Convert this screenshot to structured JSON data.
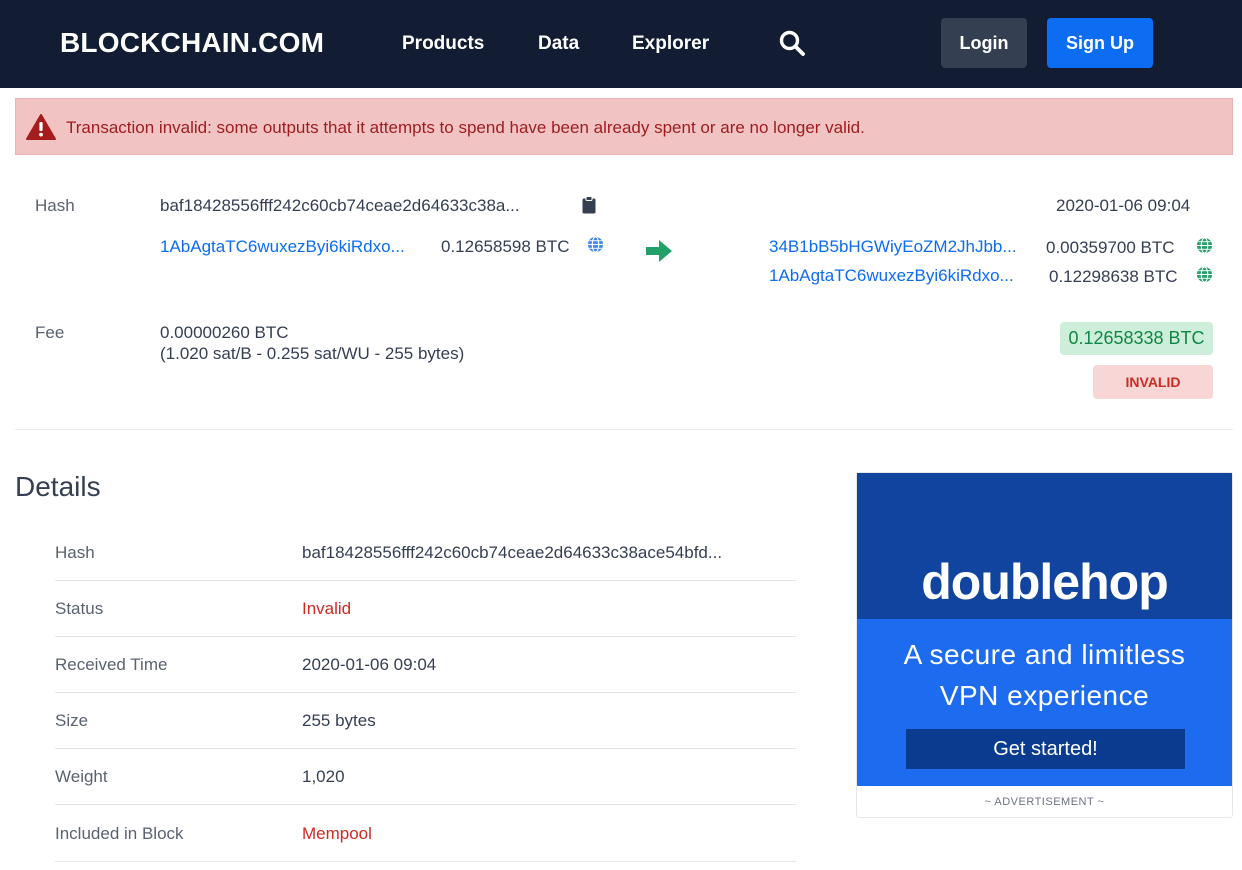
{
  "header": {
    "logo": "BLOCKCHAIN.COM",
    "nav": [
      "Products",
      "Data",
      "Explorer"
    ],
    "search_icon": "search-icon",
    "login_label": "Login",
    "signup_label": "Sign Up"
  },
  "alert": {
    "icon": "warning-icon",
    "text": "Transaction invalid: some outputs that it attempts to spend have been already spent or are no longer valid."
  },
  "tx": {
    "hash_label": "Hash",
    "hash": "baf18428556fff242c60cb74ceae2d64633c38a...",
    "time": "2020-01-06 09:04",
    "input": {
      "address": "1AbAgtaTC6wuxezByi6kiRdxo...",
      "amount": "0.12658598 BTC"
    },
    "outputs": [
      {
        "address": "34B1bB5bHGWiyEoZM2JhJbb...",
        "amount": "0.00359700 BTC"
      },
      {
        "address": "1AbAgtaTC6wuxezByi6kiRdxo...",
        "amount": "0.12298638 BTC"
      }
    ],
    "fee_label": "Fee",
    "fee": "0.00000260 BTC",
    "fee_detail": "(1.020 sat/B - 0.255 sat/WU - 255 bytes)",
    "total": "0.12658338 BTC",
    "status": "INVALID"
  },
  "details": {
    "title": "Details",
    "rows": [
      {
        "label": "Hash",
        "value": "baf18428556fff242c60cb74ceae2d64633c38ace54bfd..."
      },
      {
        "label": "Status",
        "value": "Invalid"
      },
      {
        "label": "Received Time",
        "value": "2020-01-06 09:04"
      },
      {
        "label": "Size",
        "value": "255 bytes"
      },
      {
        "label": "Weight",
        "value": "1,020"
      },
      {
        "label": "Included in Block",
        "value": "Mempool"
      }
    ]
  },
  "ad": {
    "brand": "doublehop",
    "tagline_1": "A secure and limitless",
    "tagline_2": "VPN experience",
    "cta": "Get started!",
    "label": "~ ADVERTISEMENT ~"
  },
  "colors": {
    "header_bg": "#121d33",
    "accent_blue": "#0c6cf2",
    "success_green": "#118547",
    "error_red": "#cc2b21",
    "alert_bg": "#f1c4c3"
  }
}
